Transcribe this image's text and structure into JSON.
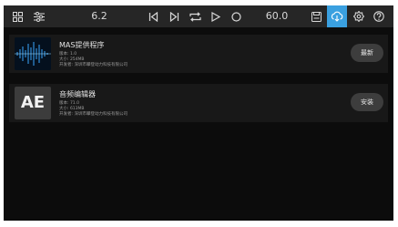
{
  "toolbar": {
    "left_value": "6.2",
    "right_value": "60.0",
    "icons": [
      "grid-icon",
      "sliders-icon",
      "skip-back-icon",
      "skip-forward-icon",
      "repeat-icon",
      "play-icon",
      "record-icon",
      "save-icon",
      "cloud-download-icon",
      "settings-icon",
      "help-icon"
    ],
    "accent_color": "#3aa0e0"
  },
  "apps": [
    {
      "name": "MAS提供程序",
      "version": "版本: 1.0",
      "size": "大小: 254MB",
      "developer": "开发者: 深圳市攀登动力科技有限公司",
      "action": "最新"
    },
    {
      "name": "音频编辑器",
      "thumb_text": "AE",
      "version": "版本: 71.0",
      "size": "大小: 613MB",
      "developer": "开发者: 深圳市攀登动力科技有限公司",
      "action": "安装"
    }
  ]
}
